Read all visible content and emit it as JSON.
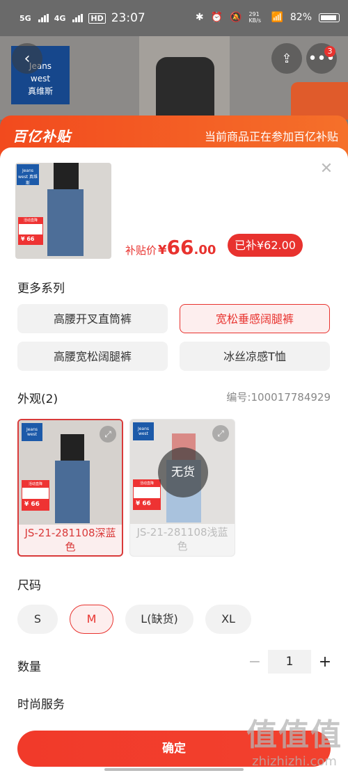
{
  "status_bar": {
    "sig1": "5G",
    "sig2": "4G",
    "hd": "HD",
    "time": "23:07",
    "net_speed": "291 KB/s",
    "battery": "82%"
  },
  "background": {
    "brand_line1": "Jeans",
    "brand_line2": "west",
    "brand_line3": "真维斯",
    "more_badge": "3"
  },
  "sheet_header": {
    "logo": "百亿补贴",
    "notice": "当前商品正在参加百亿补贴"
  },
  "product": {
    "price_label": "补贴价",
    "currency": "¥",
    "price_int": "66",
    "price_dec": ".00",
    "subsidy_badge": "已补¥62.00",
    "thumb_brand": "Jeans west 真维斯",
    "thumb_promo": "活动直降",
    "thumb_price": "¥ 66"
  },
  "series": {
    "title": "更多系列",
    "options": [
      "高腰开叉直筒裤",
      "宽松垂感阔腿裤",
      "高腰宽松阔腿裤",
      "冰丝凉感T恤"
    ]
  },
  "appearance": {
    "title": "外观(2)",
    "code": "编号:100017784929",
    "items": [
      {
        "line1": "JS-21-281108深蓝",
        "line2": "色",
        "promo": "活动直降",
        "price": "¥ 66",
        "brand": "Jeans west"
      },
      {
        "line1": "JS-21-281108浅蓝",
        "line2": "色",
        "promo": "活动直降",
        "price": "¥ 66",
        "brand": "Jeans west",
        "stock": "无货"
      }
    ]
  },
  "size": {
    "title": "尺码",
    "options": [
      "S",
      "M",
      "L(缺货)",
      "XL"
    ]
  },
  "quantity": {
    "title": "数量",
    "minus": "−",
    "value": "1",
    "plus": "+"
  },
  "service": {
    "title": "时尚服务"
  },
  "confirm_label": "确定",
  "watermark": {
    "zh": "值值值",
    "en": "zhizhizhi.com"
  },
  "colors": {
    "accent": "#e8322e",
    "header_start": "#f24a1e",
    "header_end": "#f5702a"
  }
}
